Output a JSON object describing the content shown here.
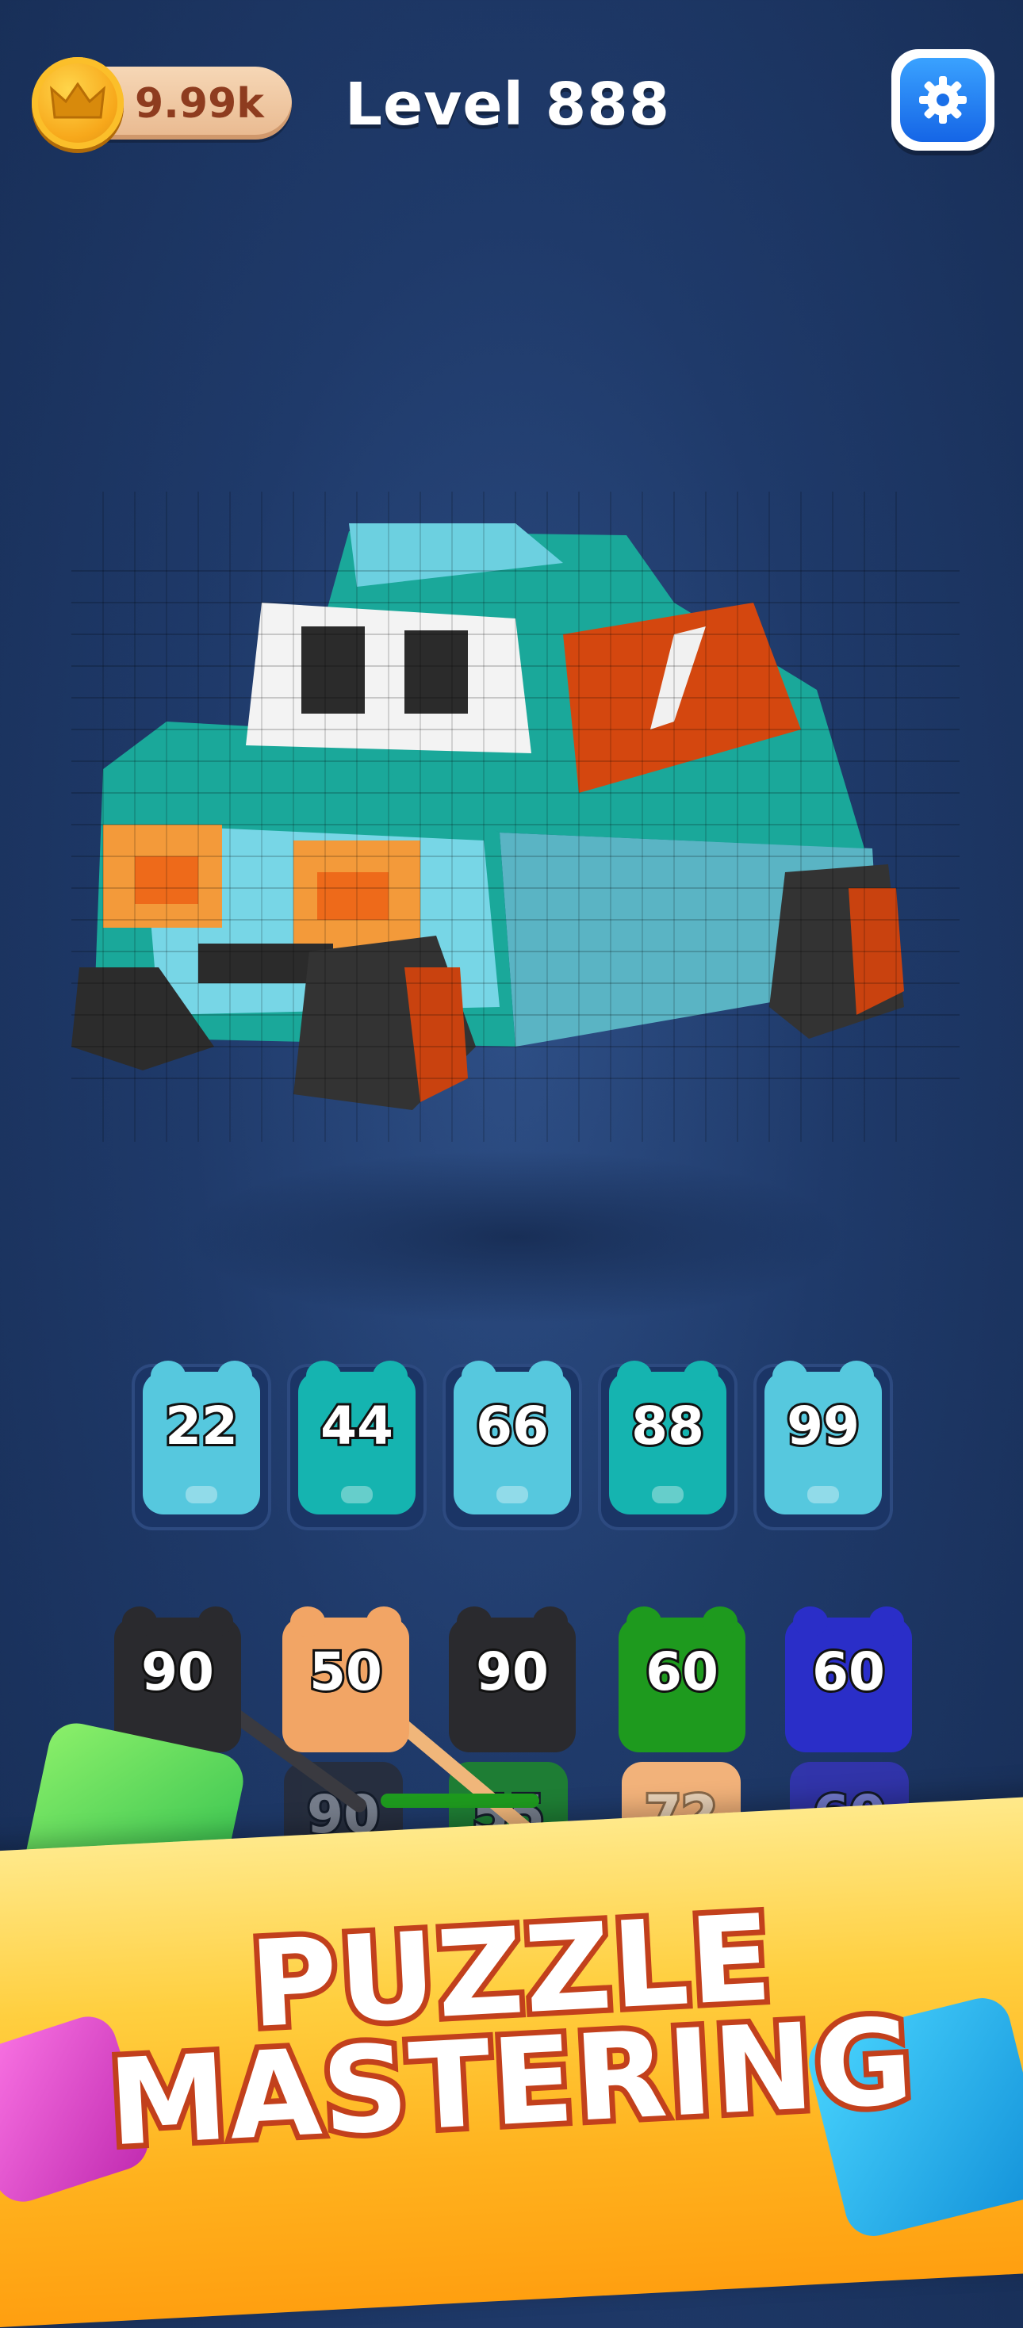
{
  "header": {
    "coins": "9.99k",
    "level_title": "Level 888"
  },
  "icons": {
    "coin": "crown-coin-icon",
    "settings": "gear-icon"
  },
  "slots": [
    {
      "value": "22",
      "color": "#56c8de"
    },
    {
      "value": "44",
      "color": "#15b4b0"
    },
    {
      "value": "66",
      "color": "#56c8de"
    },
    {
      "value": "88",
      "color": "#15b4b0"
    },
    {
      "value": "99",
      "color": "#56c8de"
    }
  ],
  "queue_front": [
    {
      "value": "90",
      "color": "#2a2a2e"
    },
    {
      "value": "50",
      "color": "#f2a565"
    },
    {
      "value": "90",
      "color": "#2a2a2e"
    },
    {
      "value": "60",
      "color": "#1e9a1e"
    },
    {
      "value": "60",
      "color": "#2a2ec8"
    }
  ],
  "queue_back": [
    {
      "value": "90",
      "color": "#2a2a2e"
    },
    {
      "value": "55",
      "color": "#1e9a1e"
    },
    {
      "value": "72",
      "color": "#f2b27a"
    },
    {
      "value": "60",
      "color": "#3a34c8"
    }
  ],
  "banner": {
    "line1": "PUZZLE",
    "line2": "MASTERING"
  }
}
